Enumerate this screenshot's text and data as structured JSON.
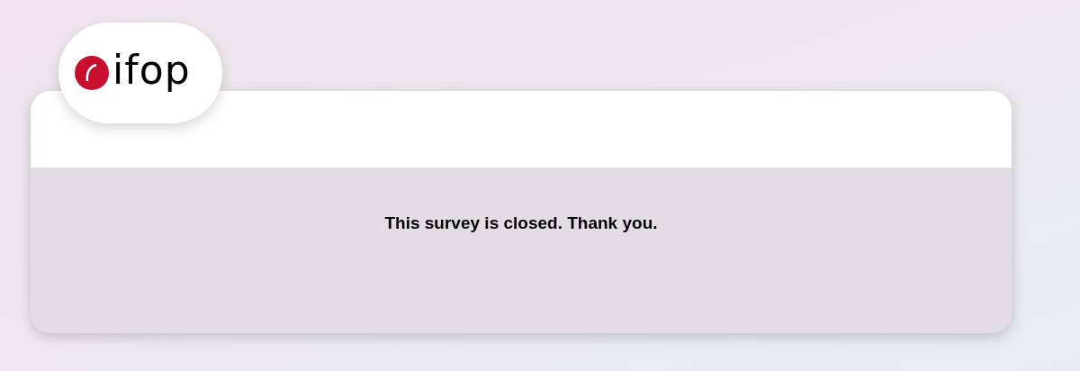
{
  "logo": {
    "text": "ifop"
  },
  "message": "This survey is closed. Thank you."
}
